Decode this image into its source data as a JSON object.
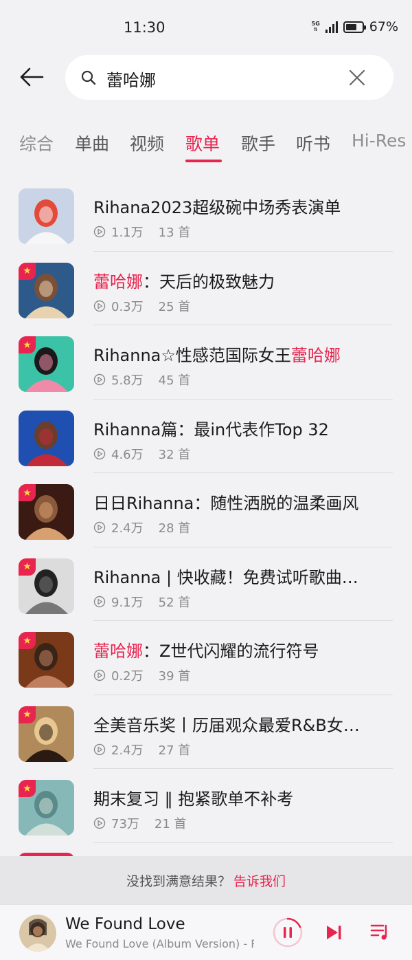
{
  "status": {
    "time": "11:30",
    "network": "5G",
    "battery_percent": "67%",
    "battery_level": 0.67
  },
  "search": {
    "query": "蕾哈娜",
    "icon": "search-icon"
  },
  "tabs": [
    {
      "label": "综合",
      "active": false
    },
    {
      "label": "单曲",
      "active": false
    },
    {
      "label": "视频",
      "active": false
    },
    {
      "label": "歌单",
      "active": true
    },
    {
      "label": "歌手",
      "active": false
    },
    {
      "label": "听书",
      "active": false
    },
    {
      "label": "Hi-Res",
      "active": false
    }
  ],
  "playlists": [
    {
      "title_parts": [
        {
          "text": "Rihana2023超级碗中场秀表演单",
          "hl": false
        }
      ],
      "plays": "1.1万",
      "tracks": "13 首",
      "featured": false
    },
    {
      "title_parts": [
        {
          "text": "蕾哈娜",
          "hl": true
        },
        {
          "text": "：天后的极致魅力",
          "hl": false
        }
      ],
      "plays": "0.3万",
      "tracks": "25 首",
      "featured": true
    },
    {
      "title_parts": [
        {
          "text": "Rihanna☆性感范国际女王",
          "hl": false
        },
        {
          "text": "蕾哈娜",
          "hl": true
        }
      ],
      "plays": "5.8万",
      "tracks": "45 首",
      "featured": true
    },
    {
      "title_parts": [
        {
          "text": "Rihanna篇：最in代表作Top 32",
          "hl": false
        }
      ],
      "plays": "4.6万",
      "tracks": "32 首",
      "featured": false
    },
    {
      "title_parts": [
        {
          "text": "日日Rihanna：随性洒脱的温柔画风",
          "hl": false
        }
      ],
      "plays": "2.4万",
      "tracks": "28 首",
      "featured": true
    },
    {
      "title_parts": [
        {
          "text": "Rihanna | 快收藏！免费试听歌曲…",
          "hl": false
        }
      ],
      "plays": "9.1万",
      "tracks": "52 首",
      "featured": true
    },
    {
      "title_parts": [
        {
          "text": "蕾哈娜",
          "hl": true
        },
        {
          "text": "：Z世代闪耀的流行符号",
          "hl": false
        }
      ],
      "plays": "0.2万",
      "tracks": "39 首",
      "featured": true
    },
    {
      "title_parts": [
        {
          "text": "全美音乐奖丨历届观众最爱R&B女…",
          "hl": false
        }
      ],
      "plays": "2.4万",
      "tracks": "27 首",
      "featured": true
    },
    {
      "title_parts": [
        {
          "text": "期末复习 ‖ 抱紧歌单不补考",
          "hl": false
        }
      ],
      "plays": "73万",
      "tracks": "21 首",
      "featured": true
    }
  ],
  "feedback": {
    "text": "没找到满意结果？",
    "link": "告诉我们"
  },
  "player": {
    "title": "We Found Love",
    "subtitle": "We Found Love (Album Version) - R",
    "state": "playing"
  },
  "colors": {
    "accent": "#e8254f",
    "background": "#f2f2f4",
    "muted_text": "#8a8a8a"
  }
}
